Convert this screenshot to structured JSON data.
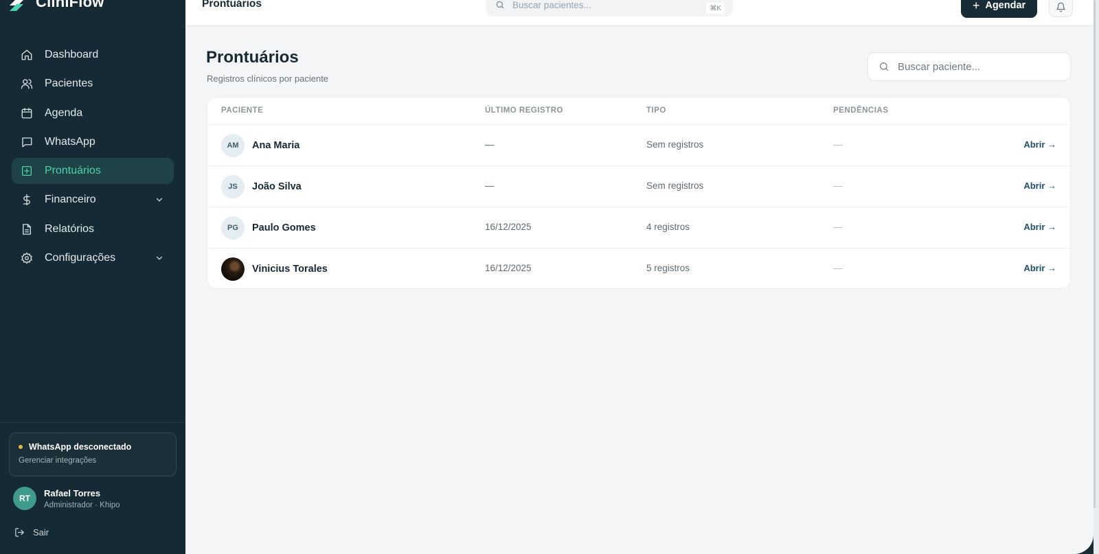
{
  "app": {
    "name": "CliniFlow"
  },
  "sidebar": {
    "items": [
      {
        "label": "Dashboard",
        "icon": "home-icon"
      },
      {
        "label": "Pacientes",
        "icon": "users-icon"
      },
      {
        "label": "Agenda",
        "icon": "calendar-icon"
      },
      {
        "label": "WhatsApp",
        "icon": "chat-icon"
      },
      {
        "label": "Prontuários",
        "icon": "medical-record-icon",
        "active": true
      },
      {
        "label": "Financeiro",
        "icon": "dollar-icon",
        "expandable": true
      },
      {
        "label": "Relatórios",
        "icon": "report-icon"
      },
      {
        "label": "Configurações",
        "icon": "gear-icon",
        "expandable": true
      }
    ],
    "whatsapp_status": {
      "title": "WhatsApp desconectado",
      "subtitle": "Gerenciar integrações",
      "dot_color": "#e7b54a"
    },
    "user": {
      "initials": "RT",
      "name": "Rafael Torres",
      "role": "Administrador · Khipo"
    },
    "logout_label": "Sair"
  },
  "topbar": {
    "title": "Prontuários",
    "search_placeholder": "Buscar pacientes...",
    "search_shortcut": "⌘K",
    "schedule_button": "Agendar"
  },
  "main": {
    "title": "Prontuários",
    "subtitle": "Registros clínicos por paciente",
    "search_placeholder": "Buscar paciente...",
    "table": {
      "columns": [
        "PACIENTE",
        "ÚLTIMO REGISTRO",
        "TIPO",
        "PENDÊNCIAS"
      ],
      "open_label": "Abrir →",
      "rows": [
        {
          "initials": "AM",
          "name": "Ana Maria",
          "last_record": "—",
          "type": "Sem registros",
          "pending": "—"
        },
        {
          "initials": "JS",
          "name": "João Silva",
          "last_record": "—",
          "type": "Sem registros",
          "pending": "—"
        },
        {
          "initials": "PG",
          "name": "Paulo Gomes",
          "last_record": "16/12/2025",
          "type": "4 registros",
          "pending": "—"
        },
        {
          "initials": "",
          "name": "Vinicius Torales",
          "last_record": "16/12/2025",
          "type": "5 registros",
          "pending": "—",
          "photo": true
        }
      ]
    }
  },
  "colors": {
    "sidebar_bg": "#152a34",
    "accent": "#4fd1b0",
    "primary_button": "#182c35",
    "link": "#1e4f6e"
  }
}
